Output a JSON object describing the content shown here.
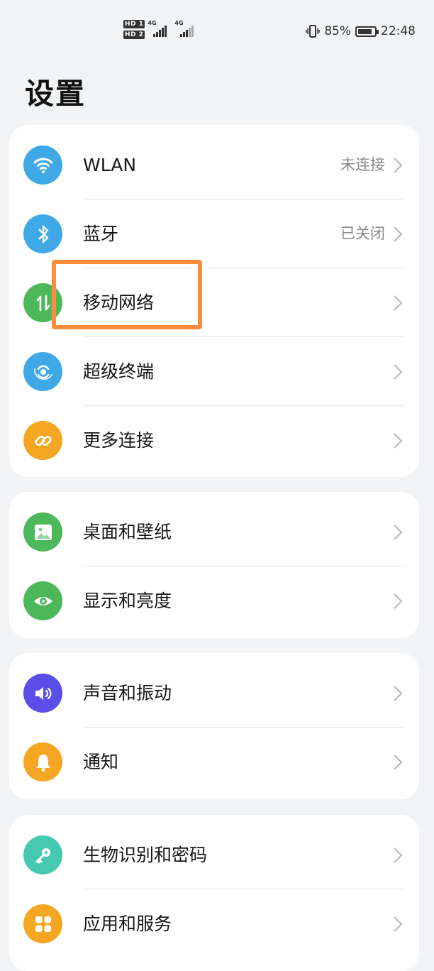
{
  "status_bar": {
    "sim1_label": "HD 1",
    "sim2_label": "HD 2",
    "sim1_network": "4G",
    "sim2_network": "4G",
    "battery_percent": "85%",
    "battery_level": 0.85,
    "time": "22:48"
  },
  "page": {
    "title": "设置"
  },
  "groups": [
    {
      "items": [
        {
          "label": "WLAN",
          "status": "未连接",
          "icon": "wifi-icon",
          "color": "#3fa9e8"
        },
        {
          "label": "蓝牙",
          "status": "已关闭",
          "icon": "bluetooth-icon",
          "color": "#3fa9e8"
        },
        {
          "label": "移动网络",
          "status": "",
          "icon": "mobile-data-icon",
          "color": "#4cb85a"
        },
        {
          "label": "超级终端",
          "status": "",
          "icon": "super-device-icon",
          "color": "#3fa9e8"
        },
        {
          "label": "更多连接",
          "status": "",
          "icon": "link-icon",
          "color": "#f5a623"
        }
      ]
    },
    {
      "items": [
        {
          "label": "桌面和壁纸",
          "status": "",
          "icon": "wallpaper-icon",
          "color": "#4cb85a"
        },
        {
          "label": "显示和亮度",
          "status": "",
          "icon": "eye-icon",
          "color": "#4cb85a"
        }
      ]
    },
    {
      "items": [
        {
          "label": "声音和振动",
          "status": "",
          "icon": "speaker-icon",
          "color": "#5b4ee8"
        },
        {
          "label": "通知",
          "status": "",
          "icon": "bell-icon",
          "color": "#f5a623"
        }
      ]
    },
    {
      "items": [
        {
          "label": "生物识别和密码",
          "status": "",
          "icon": "key-icon",
          "color": "#45c9b0"
        },
        {
          "label": "应用和服务",
          "status": "",
          "icon": "apps-icon",
          "color": "#f5a623"
        }
      ]
    }
  ],
  "highlight": {
    "target": "移动网络",
    "color": "#ff8c3a"
  }
}
